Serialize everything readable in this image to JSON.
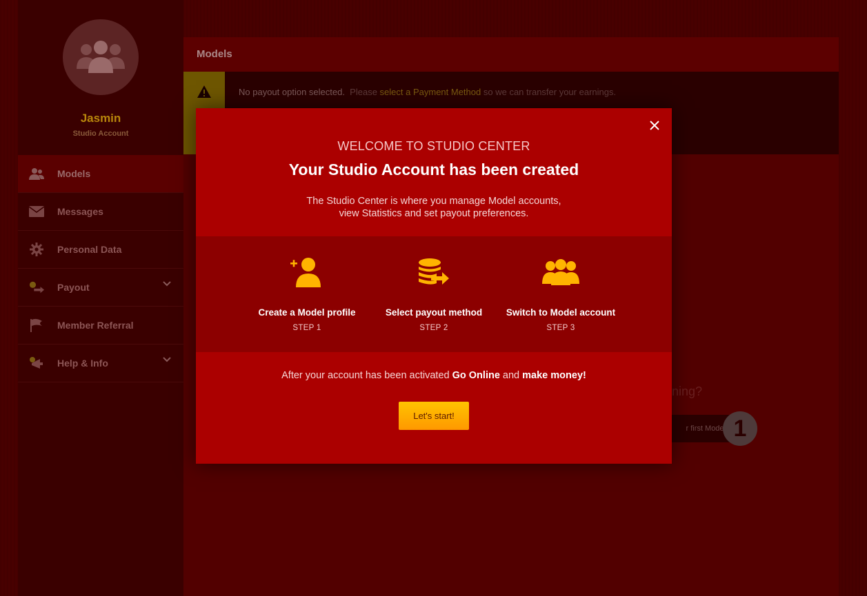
{
  "profile": {
    "name": "Jasmin",
    "subtitle": "Studio Account",
    "avatar_icon": "users-group-icon"
  },
  "sidebar": {
    "items": [
      {
        "label": "Models",
        "icon": "users-icon",
        "active": true
      },
      {
        "label": "Messages",
        "icon": "envelope-icon"
      },
      {
        "label": "Personal Data",
        "icon": "gear-icon"
      },
      {
        "label": "Payout",
        "icon": "money-transfer-icon",
        "has_chevron": true
      },
      {
        "label": "Member Referral",
        "icon": "flag-icon"
      },
      {
        "label": "Help & Info",
        "icon": "megaphone-icon",
        "has_chevron": true
      }
    ]
  },
  "main": {
    "header_title": "Models",
    "alert": {
      "icon": "warning-icon",
      "bold": "No payout option selected.",
      "text_before": "Please",
      "link": "select a Payment Method",
      "text_after": "so we can transfer your earnings."
    },
    "bg_question_fragment": "rning?",
    "bg_add_button_fragment": "r first Model",
    "bg_step_number": "1"
  },
  "modal": {
    "eyebrow": "WELCOME TO STUDIO CENTER",
    "title": "Your Studio Account has been created",
    "description_line1": "The Studio Center is where you manage Model accounts,",
    "description_line2": "view Statistics and set payout preferences.",
    "steps": [
      {
        "icon": "add-user-icon",
        "label": "Create a Model profile",
        "step": "STEP 1"
      },
      {
        "icon": "coins-transfer-icon",
        "label": "Select payout method",
        "step": "STEP 2"
      },
      {
        "icon": "users-group-icon",
        "label": "Switch to Model account",
        "step": "STEP 3"
      }
    ],
    "footer_before": "After your account has been activated",
    "footer_bold1": "Go Online",
    "footer_mid": "and",
    "footer_bold2": "make money!",
    "start_button": "Let's start!"
  },
  "colors": {
    "accent": "#ffb400",
    "modal_bg": "#ab0000",
    "steps_bg": "#8c0000"
  }
}
